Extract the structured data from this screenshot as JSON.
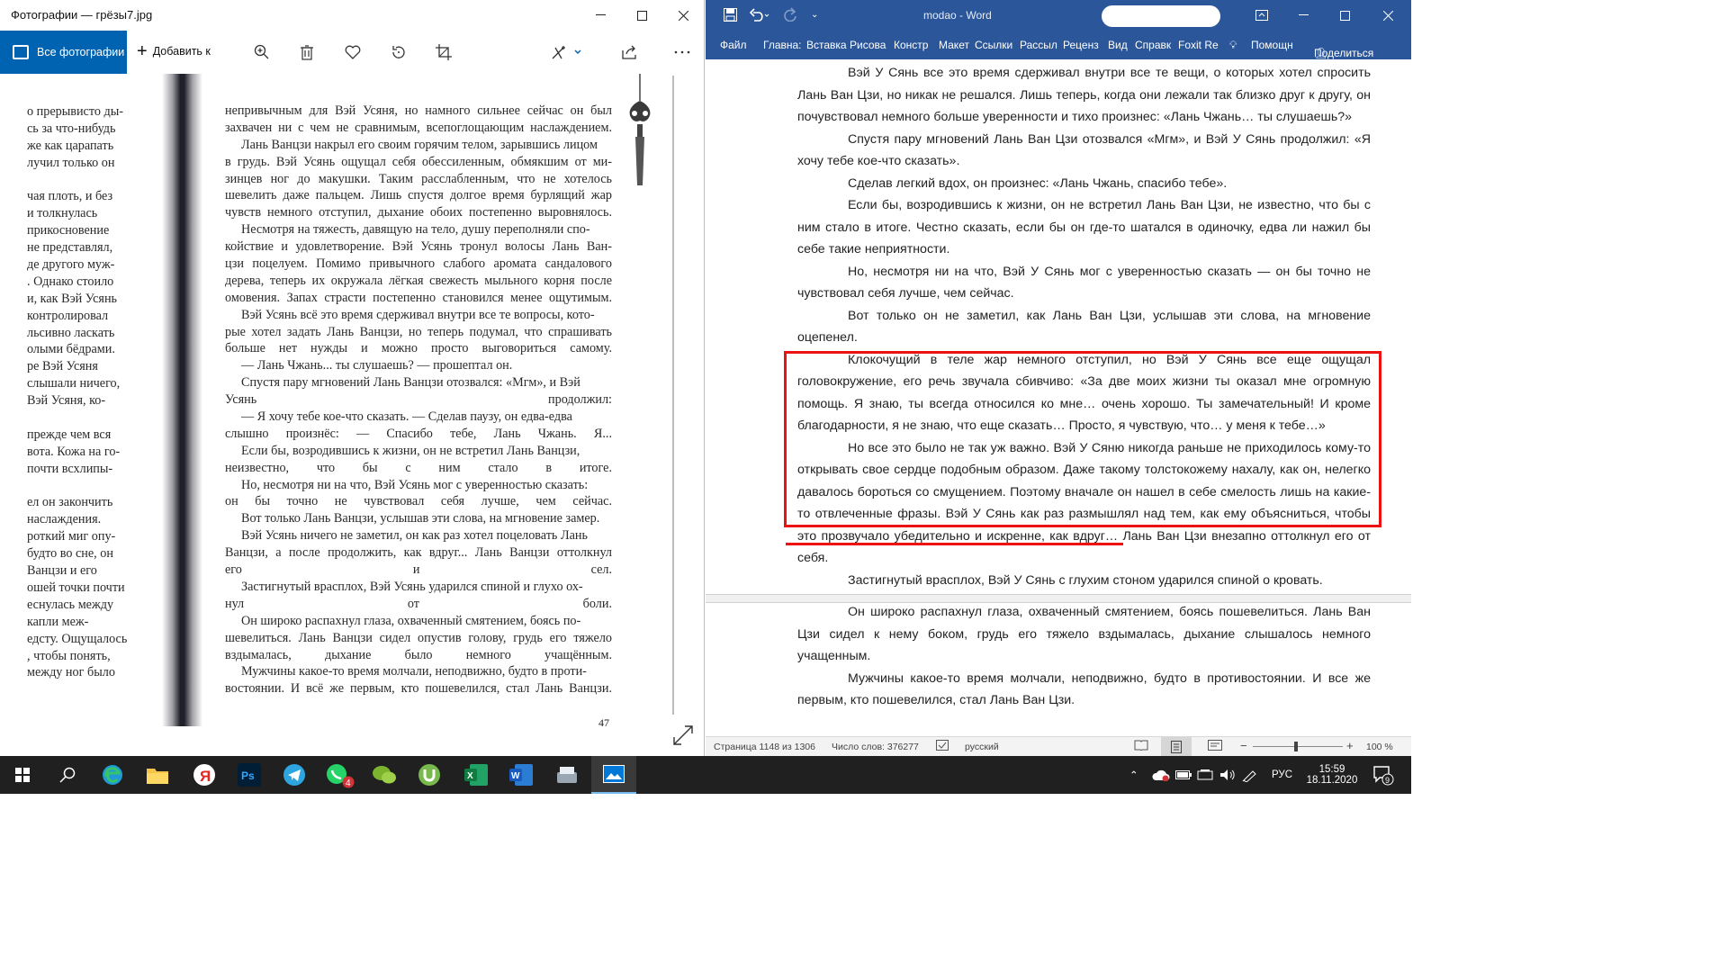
{
  "photos": {
    "title": "Фотографии — грёзы7.jpg",
    "all_photos": "Все фотографии",
    "add_label": "Добавить к",
    "left_page_lines": [
      "о прерывисто ды-",
      "сь за что-нибудь",
      "же как царапать",
      "лучил только он",
      "",
      "чая плоть, и без",
      "и толкнулась",
      "прикосновение",
      "не представлял,",
      "де другого муж-",
      ". Однако стоило",
      "и, как Вэй Усянь",
      "контролировал",
      "льсивно ласкать",
      "олыми бёдрами.",
      "ре Вэй Усяня",
      "слышали ничего,",
      "Вэй Усяня, ко-",
      "",
      "прежде чем вся",
      "вота. Кожа на го-",
      "почти всхлипы-",
      "",
      "ел он закончить",
      "наслаждения.",
      "роткий миг опу-",
      "будто во сне, он",
      "Ванцзи и его",
      "ошей точки почти",
      "еснулась между",
      "капли меж-",
      "едсту. Ощущалось",
      ", чтобы понять,",
      "между ног было"
    ],
    "right_page_lines": [
      {
        "t": "непривычным для Вэй Усяня, но намного сильнее сейчас он был",
        "i": false
      },
      {
        "t": "захвачен ни с чем не сравнимым, всепоглощающим наслаждением.",
        "i": false
      },
      {
        "t": "Лань Ванцзи накрыл его своим горячим телом, зарывшись лицом",
        "i": true
      },
      {
        "t": "в грудь. Вэй Усянь ощущал себя обессиленным, обмякшим от ми-",
        "i": false
      },
      {
        "t": "зинцев ног до макушки. Таким расслабленным, что не хотелось",
        "i": false
      },
      {
        "t": "шевелить даже пальцем. Лишь спустя долгое время бурлящий жар",
        "i": false
      },
      {
        "t": "чувств немного отступил, дыхание обоих постепенно выровнялось.",
        "i": false
      },
      {
        "t": "Несмотря на тяжесть, давящую на тело, душу переполняли спо-",
        "i": true
      },
      {
        "t": "койствие и удовлетворение. Вэй Усянь тронул волосы Лань Ван-",
        "i": false
      },
      {
        "t": "цзи поцелуем. Помимо привычного слабого аромата сандалового",
        "i": false
      },
      {
        "t": "дерева, теперь их окружала лёгкая свежесть мыльного корня после",
        "i": false
      },
      {
        "t": "омовения. Запах страсти постепенно становился менее ощутимым.",
        "i": false
      },
      {
        "t": "Вэй Усянь всё это время сдерживал внутри все те вопросы, кото-",
        "i": true
      },
      {
        "t": "рые хотел задать Лань Ванцзи, но теперь подумал, что спрашивать",
        "i": false
      },
      {
        "t": "больше нет нужды и можно просто выговориться самому.",
        "i": false
      },
      {
        "t": "— Лань Чжань... ты слушаешь? — прошептал он.",
        "i": true
      },
      {
        "t": "Спустя пару мгновений Лань Ванцзи отозвался: «Мгм», и Вэй",
        "i": true
      },
      {
        "t": "Усянь продолжил:",
        "i": false
      },
      {
        "t": "— Я хочу тебе кое-что сказать. — Сделав паузу, он едва-едва",
        "i": true
      },
      {
        "t": "слышно произнёс: — Спасибо тебе, Лань Чжань. Я...",
        "i": false
      },
      {
        "t": "Если бы, возродившись к жизни, он не встретил Лань Ванцзи,",
        "i": true
      },
      {
        "t": "неизвестно, что бы с ним стало в итоге.",
        "i": false
      },
      {
        "t": "Но, несмотря ни на что, Вэй Усянь мог с уверенностью сказать:",
        "i": true
      },
      {
        "t": "он бы точно не чувствовал себя лучше, чем сейчас.",
        "i": false
      },
      {
        "t": "Вот только Лань Ванцзи, услышав эти слова, на мгновение замер.",
        "i": true
      },
      {
        "t": "Вэй Усянь ничего не заметил, он как раз хотел поцеловать Лань",
        "i": true
      },
      {
        "t": "Ванцзи, а после продолжить, как вдруг... Лань Ванцзи оттолкнул",
        "i": false
      },
      {
        "t": "его и сел.",
        "i": false
      },
      {
        "t": "Застигнутый врасплох, Вэй Усянь ударился спиной и глухо ох-",
        "i": true
      },
      {
        "t": "нул от боли.",
        "i": false
      },
      {
        "t": "Он широко распахнул глаза, охваченный смятением, боясь по-",
        "i": true
      },
      {
        "t": "шевелиться. Лань Ванцзи сидел опустив голову, грудь его тяжело",
        "i": false
      },
      {
        "t": "вздымалась, дыхание было немного учащённым.",
        "i": false
      },
      {
        "t": "Мужчины какое-то время молчали, неподвижно, будто в проти-",
        "i": true
      },
      {
        "t": "востоянии. И всё же первым, кто пошевелился, стал Лань Ванцзи.",
        "i": false
      }
    ],
    "page_number": "47"
  },
  "word": {
    "doc_name": "modao",
    "app_name": "Word",
    "tabs": [
      "Файл",
      "Главна:",
      "Вставка",
      "Рисова",
      "Констр",
      "Макет",
      "Ссылки",
      "Рассыл",
      "Реценз",
      "Вид",
      "Справк",
      "Foxit Re"
    ],
    "help_label": "Помощн",
    "share_label": "Поделиться",
    "document_lines": [
      {
        "t": "Вэй У Сянь все это время сдерживал внутри все те вещи, о которых хотел спросить",
        "s": "i"
      },
      {
        "t": "Лань Ван Цзи, но никак не решался. Лишь теперь, когда они лежали так близко друг к другу, он",
        "s": "j"
      },
      {
        "t": "почувствовал немного больше уверенности и тихо произнес: «Лань Чжань… ты слушаешь?»",
        "s": "l"
      },
      {
        "t": "Спустя пару мгновений Лань Ван Цзи отозвался «Мгм», и Вэй У Сянь продолжил: «Я",
        "s": "i"
      },
      {
        "t": "хочу тебе кое-что сказать».",
        "s": "l"
      },
      {
        "t": "Сделав легкий вдох, он произнес: «Лань Чжань, спасибо тебе».",
        "s": "il"
      },
      {
        "t": "Если бы, возродившись к жизни, он не встретил Лань Ван Цзи, не известно, что бы с",
        "s": "i"
      },
      {
        "t": "ним стало в итоге. Честно сказать, если бы он где-то шатался в одиночку, едва ли нажил бы",
        "s": "j"
      },
      {
        "t": "себе такие неприятности.",
        "s": "l"
      },
      {
        "t": "Но, несмотря ни на что, Вэй У Сянь мог с уверенностью сказать — он бы точно не",
        "s": "i"
      },
      {
        "t": "чувствовал себя лучше, чем сейчас.",
        "s": "l"
      },
      {
        "t": "Вот только он не заметил, как Лань Ван Цзи, услышав эти слова, на мгновение",
        "s": "i"
      },
      {
        "t": "оцепенел.",
        "s": "l"
      },
      {
        "t": "Клокочущий в теле жар немного отступил, но Вэй У Сянь все еще ощущал",
        "s": "i"
      },
      {
        "t": "головокружение, его речь звучала сбивчиво: «За две моих жизни ты оказал мне огромную",
        "s": "j"
      },
      {
        "t": "помощь. Я знаю, ты всегда относился ко мне… очень хорошо. Ты замечательный! И кроме",
        "s": "j"
      },
      {
        "t": "благодарности, я не знаю, что еще сказать… Просто, я чувствую, что… у меня к тебе…»",
        "s": "l"
      },
      {
        "t": "Но все это было не так уж важно. Вэй У Сяню никогда раньше не приходилось кому-то",
        "s": "i"
      },
      {
        "t": "открывать свое сердце подобным образом. Даже такому толстокожему нахалу, как он, нелегко",
        "s": "j"
      },
      {
        "t": "давалось бороться со смущением. Поэтому вначале он нашел в себе смелость лишь на какие-",
        "s": "j"
      },
      {
        "t": "то отвлеченные фразы. Вэй У Сянь как раз размышлял над тем, как ему объясниться, чтобы",
        "s": "j"
      },
      {
        "t": "это прозвучало убедительно и искренне, как вдруг… Лань Ван Цзи внезапно оттолкнул его от",
        "s": "j"
      },
      {
        "t": "себя.",
        "s": "l"
      },
      {
        "t": "Застигнутый врасплох, Вэй У Сянь с глухим стоном ударился спиной о кровать.",
        "s": "il"
      }
    ],
    "document_lines_page2": [
      {
        "t": "Он широко распахнул глаза, охваченный смятением, боясь пошевелиться. Лань Ван",
        "s": "i"
      },
      {
        "t": "Цзи сидел к нему боком, грудь его тяжело вздымалась, дыхание слышалось немного",
        "s": "j"
      },
      {
        "t": "учащенным.",
        "s": "l"
      },
      {
        "t": "Мужчины какое-то время молчали, неподвижно, будто в противостоянии. И все же",
        "s": "i"
      },
      {
        "t": "первым, кто пошевелился, стал Лань Ван Цзи.",
        "s": "l"
      }
    ],
    "status_page": "Страница 1148 из 1306",
    "status_words": "Число слов: 376277",
    "status_lang": "русский",
    "zoom": "100 %"
  },
  "taskbar": {
    "lang": "РУС",
    "time": "15:59",
    "date": "18.11.2020",
    "whatsapp_badge": "4",
    "notif_count": "9"
  },
  "colors": {
    "word_blue": "#2b579a",
    "photos_accent": "#0063b1",
    "highlight_red": "#ee1111"
  }
}
